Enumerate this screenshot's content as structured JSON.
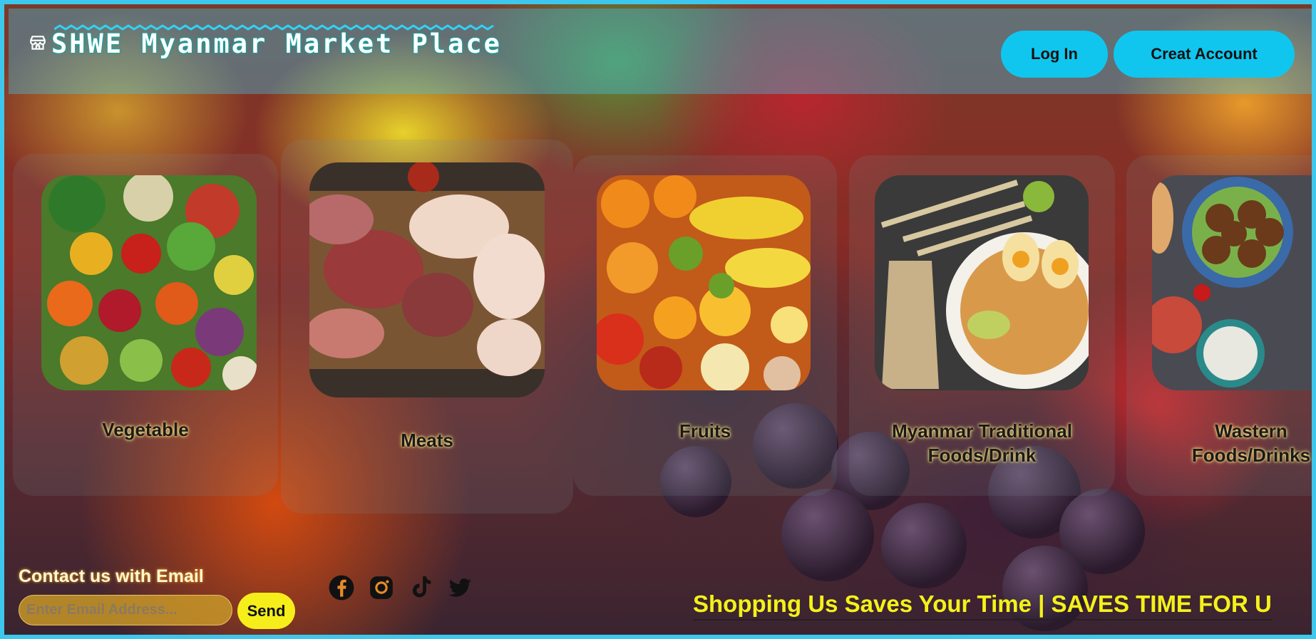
{
  "brand": {
    "title": "SHWE Myanmar Market Place",
    "icon": "store-icon"
  },
  "header": {
    "login_label": "Log In",
    "create_account_label": "Creat Account"
  },
  "categories": [
    {
      "label": "Vegetable"
    },
    {
      "label": "Meats"
    },
    {
      "label": "Fruits"
    },
    {
      "label": "Myanmar Traditional Foods/Drink"
    },
    {
      "label": "Wastern Foods/Drinks"
    }
  ],
  "contact": {
    "title": "Contact us with Email",
    "email_placeholder": "Enter Email Address...",
    "send_label": "Send"
  },
  "social": [
    "facebook-icon",
    "instagram-icon",
    "tiktok-icon",
    "twitter-icon"
  ],
  "marquee": {
    "text": "Shopping Us Saves Your Time | SAVES TIME FOR U"
  },
  "colors": {
    "accent": "#10c6ee",
    "send": "#f6ee1a",
    "marquee": "#f6f01a"
  }
}
